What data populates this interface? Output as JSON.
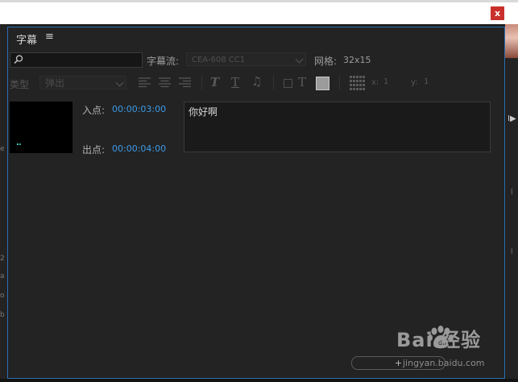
{
  "dialog": {
    "close_label": "x"
  },
  "panel": {
    "title": "字幕",
    "menu_icon": "≡",
    "search": {
      "value": "",
      "placeholder": ""
    },
    "stream_label": "字幕流:",
    "stream_value": "CEA-608 CC1",
    "grid_label": "网格:",
    "grid_value": "32x15",
    "type_label": "类型",
    "type_value": "弹出",
    "x_label": "x:",
    "x_value": "1",
    "y_label": "y:",
    "y_value": "1",
    "in_label": "入点:",
    "in_value": "00:00:03:00",
    "out_label": "出点:",
    "out_value": "00:00:04:00",
    "caption_text": "你好啊",
    "add_label": "+"
  },
  "side_left_text": [
    "e",
    "2",
    "a",
    "o",
    "b"
  ],
  "side_right_text": [
    "I▶",
    "l",
    "l"
  ],
  "colors": {
    "accent": "#3d9ae8",
    "border": "#2d6fb2",
    "close": "#c9302c"
  },
  "watermark": {
    "brand": "Bai 经验",
    "url": "jingyan.baidu.com"
  }
}
